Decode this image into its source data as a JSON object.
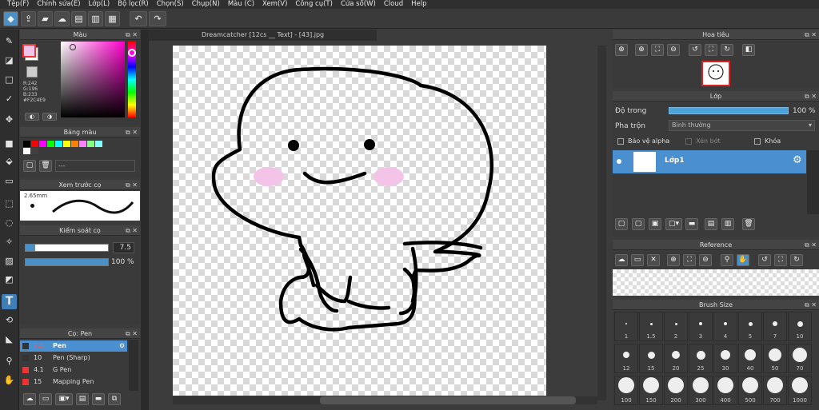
{
  "menu": [
    "Tệp(F)",
    "Chỉnh sửa(E)",
    "Lớp(L)",
    "Bộ lọc(R)",
    "Chọn(S)",
    "Chụp(N)",
    "Màu (C)",
    "Xem(V)",
    "Công cụ(T)",
    "Cửa sổ(W)",
    "Cloud",
    "Help"
  ],
  "panels": {
    "color": "Màu",
    "palette": "Bảng màu",
    "palette_field": "---",
    "brush_preview": "Xem trước cọ",
    "brush_preview_size": "2.65mm",
    "brush_control": "Kiểm soát cọ",
    "brush_control_size": "7.5",
    "brush_control_opacity": "100 %",
    "brush_list": "Cọ: Pen",
    "navigator": "Hoa tiêu",
    "layer": "Lớp",
    "reference": "Reference",
    "brush_size": "Brush Size"
  },
  "color": {
    "r": "R:242",
    "g": "G:196",
    "b": "B:233",
    "hex": "#F2C4E9",
    "fg": "#F2C4E9",
    "bg": "#ffffff"
  },
  "palette_colors": [
    "#000000",
    "#ff0000",
    "#ff00ff",
    "#00ff00",
    "#00ffff",
    "#ffff00",
    "#ff8000",
    "#ff80ff",
    "#80ff80",
    "#80ffff",
    "#ffffff",
    "#404040"
  ],
  "document": {
    "tab_title": "Dreamcatcher [12cs __ Text] - [43].jpg"
  },
  "layer": {
    "opacity_label": "Độ trong",
    "opacity_value": "100 %",
    "blend_label": "Pha trộn",
    "blend_value": "Bình thường",
    "protect_alpha": "Bảo vệ alpha",
    "clipping": "Xén bớt",
    "lock": "Khóa",
    "layer_name": "Lớp1"
  },
  "brushes": [
    {
      "size": "7.5",
      "name": "Pen",
      "selected": true
    },
    {
      "size": "10",
      "name": "Pen (Sharp)",
      "selected": false
    },
    {
      "size": "4.1",
      "name": "G Pen",
      "selected": false
    },
    {
      "size": "15",
      "name": "Mapping Pen",
      "selected": false
    }
  ],
  "brush_sizes": [
    "1",
    "1.5",
    "2",
    "3",
    "4",
    "5",
    "7",
    "10",
    "12",
    "15",
    "20",
    "25",
    "30",
    "40",
    "50",
    "70",
    "100",
    "150",
    "200",
    "300",
    "400",
    "500",
    "700",
    "1000"
  ],
  "colors": {
    "accent": "#4a90c8",
    "selected_row": "#4a8fd0"
  }
}
